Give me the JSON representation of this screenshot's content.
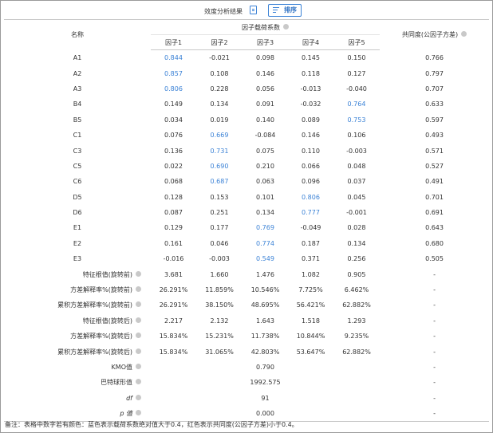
{
  "toolbar": {
    "title": "效度分析结果",
    "sort_label": "排序"
  },
  "header": {
    "name_col": "名称",
    "group_col": "因子载荷系数",
    "communality_col": "共同度(公因子方差)",
    "factors": [
      "因子1",
      "因子2",
      "因子3",
      "因子4",
      "因子5"
    ]
  },
  "loading_rows": [
    {
      "name": "A1",
      "values": [
        "0.844",
        "-0.021",
        "0.098",
        "0.145",
        "0.150"
      ],
      "communality": "0.766",
      "highlight": 0
    },
    {
      "name": "A2",
      "values": [
        "0.857",
        "0.108",
        "0.146",
        "0.118",
        "0.127"
      ],
      "communality": "0.797",
      "highlight": 0
    },
    {
      "name": "A3",
      "values": [
        "0.806",
        "0.228",
        "0.056",
        "-0.013",
        "-0.040"
      ],
      "communality": "0.707",
      "highlight": 0
    },
    {
      "name": "B4",
      "values": [
        "0.149",
        "0.134",
        "0.091",
        "-0.032",
        "0.764"
      ],
      "communality": "0.633",
      "highlight": 4
    },
    {
      "name": "B5",
      "values": [
        "0.034",
        "0.019",
        "0.140",
        "0.089",
        "0.753"
      ],
      "communality": "0.597",
      "highlight": 4
    },
    {
      "name": "C1",
      "values": [
        "0.076",
        "0.669",
        "-0.084",
        "0.146",
        "0.106"
      ],
      "communality": "0.493",
      "highlight": 1
    },
    {
      "name": "C3",
      "values": [
        "0.136",
        "0.731",
        "0.075",
        "0.110",
        "-0.003"
      ],
      "communality": "0.571",
      "highlight": 1
    },
    {
      "name": "C5",
      "values": [
        "0.022",
        "0.690",
        "0.210",
        "0.066",
        "0.048"
      ],
      "communality": "0.527",
      "highlight": 1
    },
    {
      "name": "C6",
      "values": [
        "0.068",
        "0.687",
        "0.063",
        "0.096",
        "0.037"
      ],
      "communality": "0.491",
      "highlight": 1
    },
    {
      "name": "D5",
      "values": [
        "0.128",
        "0.153",
        "0.101",
        "0.806",
        "0.045"
      ],
      "communality": "0.701",
      "highlight": 3
    },
    {
      "name": "D6",
      "values": [
        "0.087",
        "0.251",
        "0.134",
        "0.777",
        "-0.001"
      ],
      "communality": "0.691",
      "highlight": 3
    },
    {
      "name": "E1",
      "values": [
        "0.129",
        "0.177",
        "0.769",
        "-0.049",
        "0.028"
      ],
      "communality": "0.643",
      "highlight": 2
    },
    {
      "name": "E2",
      "values": [
        "0.161",
        "0.046",
        "0.774",
        "0.187",
        "0.134"
      ],
      "communality": "0.680",
      "highlight": 2
    },
    {
      "name": "E3",
      "values": [
        "-0.016",
        "-0.003",
        "0.549",
        "0.371",
        "0.256"
      ],
      "communality": "0.505",
      "highlight": 2
    }
  ],
  "stat_rows": [
    {
      "name": "特征根值(旋转前)",
      "values": [
        "3.681",
        "1.660",
        "1.476",
        "1.082",
        "0.905"
      ],
      "communality": "-"
    },
    {
      "name": "方差解释率%(旋转前)",
      "values": [
        "26.291%",
        "11.859%",
        "10.546%",
        "7.725%",
        "6.462%"
      ],
      "communality": "-"
    },
    {
      "name": "累积方差解释率%(旋转前)",
      "values": [
        "26.291%",
        "38.150%",
        "48.695%",
        "56.421%",
        "62.882%"
      ],
      "communality": "-"
    },
    {
      "name": "特征根值(旋转后)",
      "values": [
        "2.217",
        "2.132",
        "1.643",
        "1.518",
        "1.293"
      ],
      "communality": "-"
    },
    {
      "name": "方差解释率%(旋转后)",
      "values": [
        "15.834%",
        "15.231%",
        "11.738%",
        "10.844%",
        "9.235%"
      ],
      "communality": "-"
    },
    {
      "name": "累积方差解释率%(旋转后)",
      "values": [
        "15.834%",
        "31.065%",
        "42.803%",
        "53.647%",
        "62.882%"
      ],
      "communality": "-"
    }
  ],
  "test_rows": [
    {
      "name": "KMO值",
      "value": "0.790",
      "communality": "-",
      "italic": false
    },
    {
      "name": "巴特球形值",
      "value": "1992.575",
      "communality": "-",
      "italic": false
    },
    {
      "name": "df",
      "value": "91",
      "communality": "-",
      "italic": true
    },
    {
      "name": "p 值",
      "value": "0.000",
      "communality": "-",
      "italic": true
    }
  ],
  "footnote": "备注：表格中数字若有颜色：蓝色表示载荷系数绝对值大于0.4，红色表示共同度(公因子方差)小于0.4。",
  "colors": {
    "highlight": "#3b82d6",
    "help_icon": "#c9c9c9",
    "border": "#c8c8c8"
  }
}
